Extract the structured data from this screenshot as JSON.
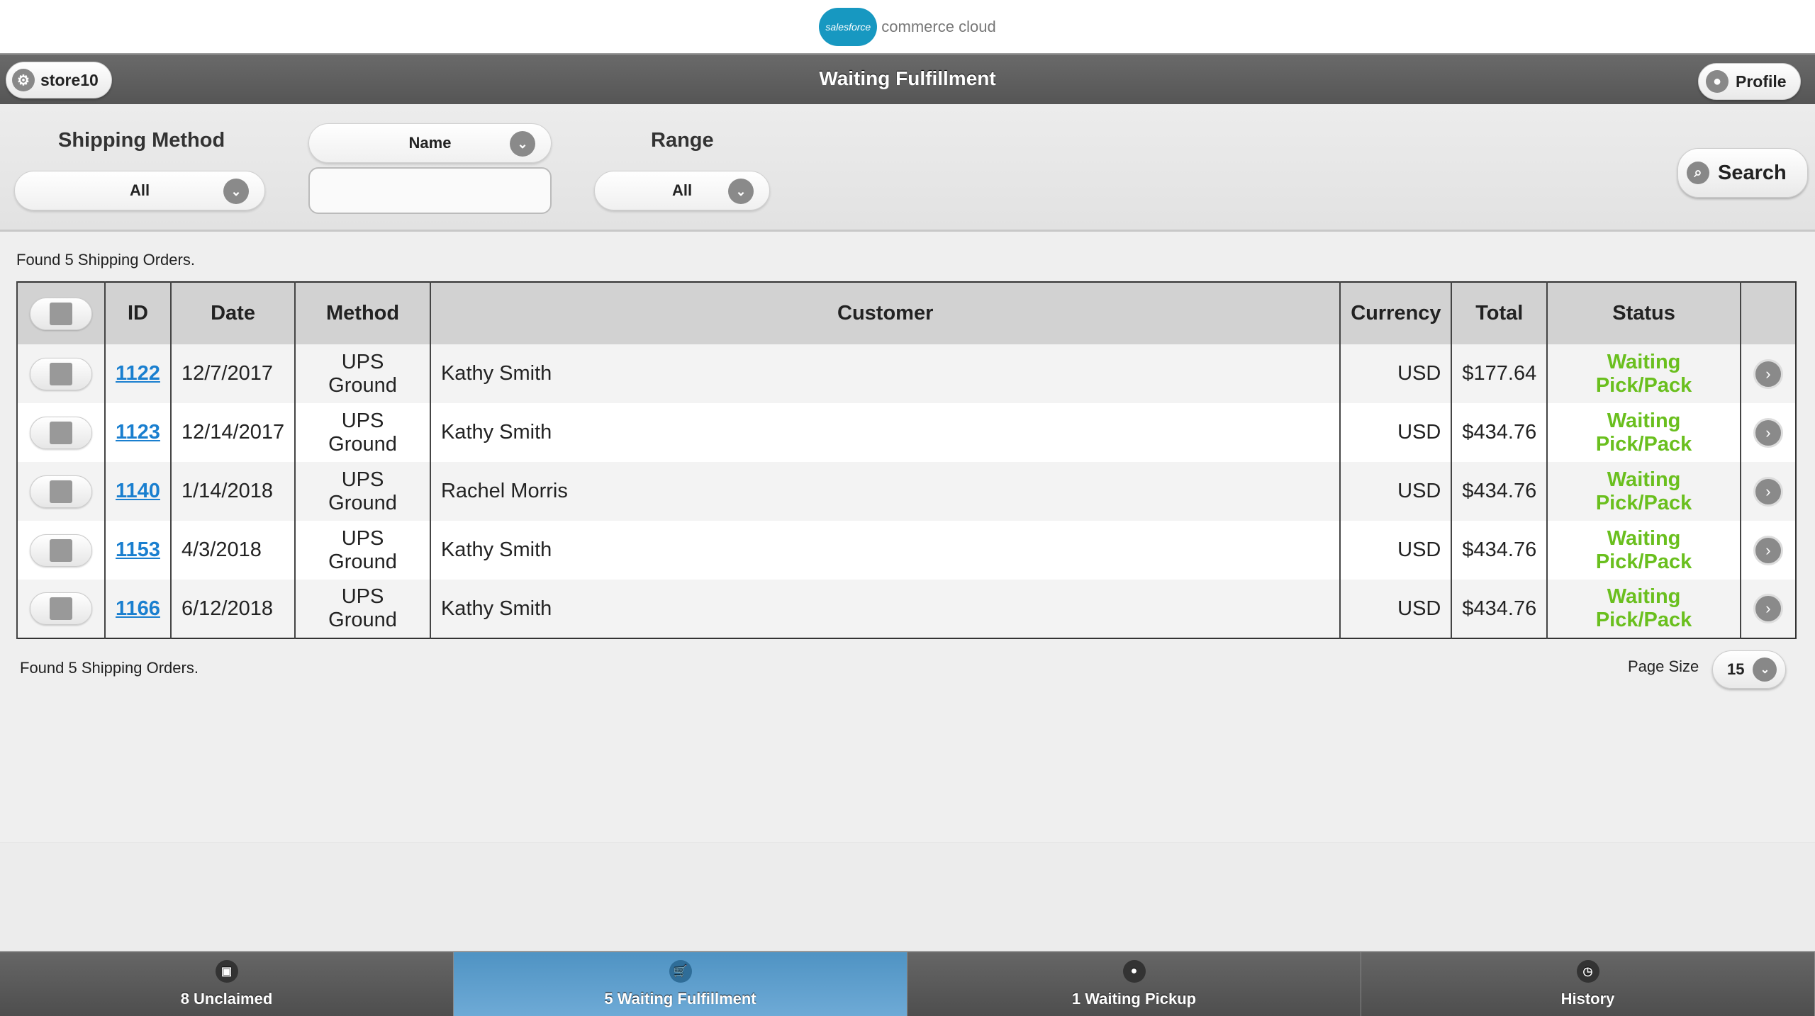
{
  "brand": {
    "cloud_text": "salesforce",
    "text": "commerce cloud"
  },
  "header": {
    "store": "store10",
    "title": "Waiting Fulfillment",
    "profile": "Profile"
  },
  "filters": {
    "shipping_label": "Shipping Method",
    "shipping_value": "All",
    "name_select": "Name",
    "name_value": "",
    "range_label": "Range",
    "range_value": "All",
    "search": "Search"
  },
  "found_text": "Found 5 Shipping Orders.",
  "table": {
    "headers": [
      "",
      "ID",
      "Date",
      "Method",
      "Customer",
      "Currency",
      "Total",
      "Status",
      ""
    ],
    "rows": [
      {
        "id": "1122",
        "date": "12/7/2017",
        "method": "UPS Ground",
        "customer": "Kathy Smith",
        "currency": "USD",
        "total": "$177.64",
        "status": "Waiting Pick/Pack"
      },
      {
        "id": "1123",
        "date": "12/14/2017",
        "method": "UPS Ground",
        "customer": "Kathy Smith",
        "currency": "USD",
        "total": "$434.76",
        "status": "Waiting Pick/Pack"
      },
      {
        "id": "1140",
        "date": "1/14/2018",
        "method": "UPS Ground",
        "customer": "Rachel Morris",
        "currency": "USD",
        "total": "$434.76",
        "status": "Waiting Pick/Pack"
      },
      {
        "id": "1153",
        "date": "4/3/2018",
        "method": "UPS Ground",
        "customer": "Kathy Smith",
        "currency": "USD",
        "total": "$434.76",
        "status": "Waiting Pick/Pack"
      },
      {
        "id": "1166",
        "date": "6/12/2018",
        "method": "UPS Ground",
        "customer": "Kathy Smith",
        "currency": "USD",
        "total": "$434.76",
        "status": "Waiting Pick/Pack"
      }
    ]
  },
  "footer": {
    "found_text": "Found 5 Shipping Orders.",
    "page_size_label": "Page Size",
    "page_size": "15"
  },
  "nav": [
    {
      "label": "8 Unclaimed",
      "icon": "inbox-icon"
    },
    {
      "label": "5 Waiting Fulfillment",
      "icon": "cart-icon",
      "active": true
    },
    {
      "label": "1 Waiting Pickup",
      "icon": "person-icon"
    },
    {
      "label": "History",
      "icon": "history-icon"
    }
  ],
  "colors": {
    "status": "#6abf1e",
    "link": "#1a7fcf",
    "active_tab": "#5a9fcd"
  }
}
